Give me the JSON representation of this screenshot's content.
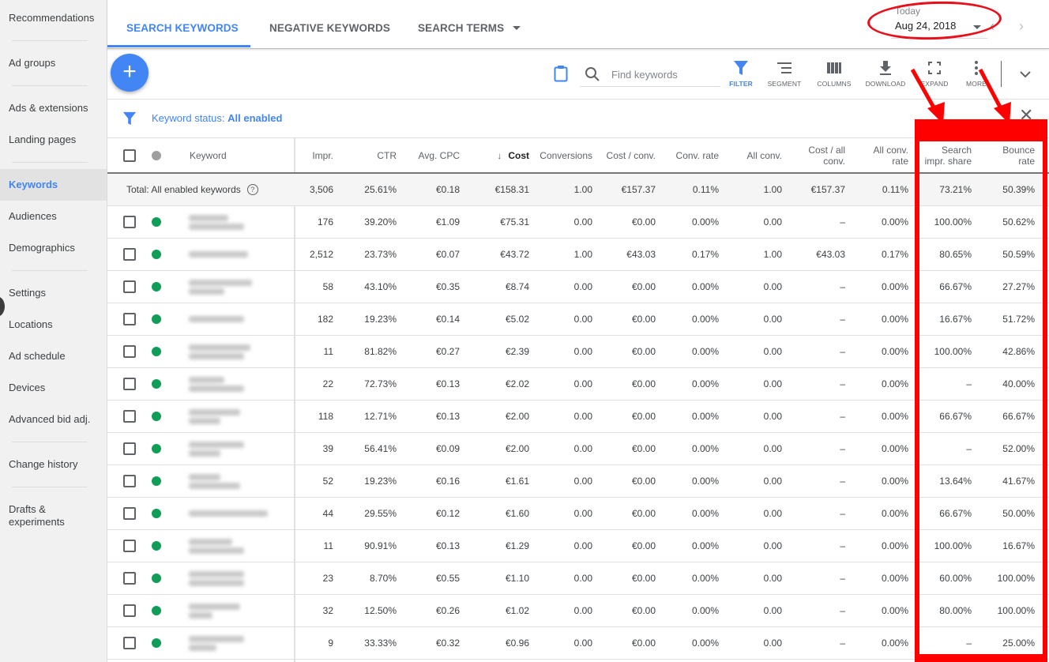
{
  "sidebar": {
    "items": [
      {
        "label": "Recommendations",
        "active": false
      },
      {
        "label": "Ad groups",
        "active": false
      },
      {
        "label": "Ads & extensions",
        "active": false
      },
      {
        "label": "Landing pages",
        "active": false
      },
      {
        "label": "Keywords",
        "active": true
      },
      {
        "label": "Audiences",
        "active": false
      },
      {
        "label": "Demographics",
        "active": false
      },
      {
        "label": "Settings",
        "active": false
      },
      {
        "label": "Locations",
        "active": false
      },
      {
        "label": "Ad schedule",
        "active": false
      },
      {
        "label": "Devices",
        "active": false
      },
      {
        "label": "Advanced bid adj.",
        "active": false
      },
      {
        "label": "Change history",
        "active": false
      },
      {
        "label": "Drafts & experiments",
        "active": false
      }
    ]
  },
  "tabs": [
    {
      "label": "SEARCH KEYWORDS",
      "active": true
    },
    {
      "label": "NEGATIVE KEYWORDS",
      "active": false
    },
    {
      "label": "SEARCH TERMS",
      "active": false
    }
  ],
  "date_range": {
    "label": "Today",
    "value": "Aug 24, 2018"
  },
  "toolbar": {
    "add_icon": "plus-icon",
    "search_placeholder": "Find keywords",
    "filter_label": "FILTER",
    "segment_label": "SEGMENT",
    "columns_label": "COLUMNS",
    "download_label": "DOWNLOAD",
    "expand_label": "EXPAND",
    "more_label": "MORE"
  },
  "filter": {
    "prefix": "Keyword status: ",
    "value": "All enabled"
  },
  "table": {
    "headers": {
      "keyword": "Keyword",
      "impr": "Impr.",
      "ctr": "CTR",
      "avg_cpc": "Avg. CPC",
      "cost": "Cost",
      "conversions": "Conversions",
      "cost_conv": "Cost / conv.",
      "conv_rate": "Conv. rate",
      "all_conv": "All conv.",
      "cost_all_conv": "Cost / all conv.",
      "all_conv_rate": "All conv. rate",
      "search_impr_share": "Search impr. share",
      "bounce_rate": "Bounce rate"
    },
    "sort_icon": "arrow-down-icon",
    "total": {
      "label": "Total: All enabled keywords",
      "impr": "3,506",
      "ctr": "25.61%",
      "avg_cpc": "€0.18",
      "cost": "€158.31",
      "conversions": "1.00",
      "cost_conv": "€157.37",
      "conv_rate": "0.11%",
      "all_conv": "1.00",
      "cost_all_conv": "€157.37",
      "all_conv_rate": "0.11%",
      "search_impr_share": "73.21%",
      "bounce_rate": "50.39%"
    },
    "status_color": "#0f9d58",
    "rows": [
      {
        "impr": "176",
        "ctr": "39.20%",
        "avg_cpc": "€1.09",
        "cost": "€75.31",
        "conversions": "0.00",
        "cost_conv": "€0.00",
        "conv_rate": "0.00%",
        "all_conv": "0.00",
        "cost_all_conv": "–",
        "all_conv_rate": "0.00%",
        "search_impr_share": "100.00%",
        "bounce_rate": "50.62%"
      },
      {
        "impr": "2,512",
        "ctr": "23.73%",
        "avg_cpc": "€0.07",
        "cost": "€43.72",
        "conversions": "1.00",
        "cost_conv": "€43.03",
        "conv_rate": "0.17%",
        "all_conv": "1.00",
        "cost_all_conv": "€43.03",
        "all_conv_rate": "0.17%",
        "search_impr_share": "80.65%",
        "bounce_rate": "50.59%"
      },
      {
        "impr": "58",
        "ctr": "43.10%",
        "avg_cpc": "€0.35",
        "cost": "€8.74",
        "conversions": "0.00",
        "cost_conv": "€0.00",
        "conv_rate": "0.00%",
        "all_conv": "0.00",
        "cost_all_conv": "–",
        "all_conv_rate": "0.00%",
        "search_impr_share": "66.67%",
        "bounce_rate": "27.27%"
      },
      {
        "impr": "182",
        "ctr": "19.23%",
        "avg_cpc": "€0.14",
        "cost": "€5.02",
        "conversions": "0.00",
        "cost_conv": "€0.00",
        "conv_rate": "0.00%",
        "all_conv": "0.00",
        "cost_all_conv": "–",
        "all_conv_rate": "0.00%",
        "search_impr_share": "16.67%",
        "bounce_rate": "51.72%"
      },
      {
        "impr": "11",
        "ctr": "81.82%",
        "avg_cpc": "€0.27",
        "cost": "€2.39",
        "conversions": "0.00",
        "cost_conv": "€0.00",
        "conv_rate": "0.00%",
        "all_conv": "0.00",
        "cost_all_conv": "–",
        "all_conv_rate": "0.00%",
        "search_impr_share": "100.00%",
        "bounce_rate": "42.86%"
      },
      {
        "impr": "22",
        "ctr": "72.73%",
        "avg_cpc": "€0.13",
        "cost": "€2.02",
        "conversions": "0.00",
        "cost_conv": "€0.00",
        "conv_rate": "0.00%",
        "all_conv": "0.00",
        "cost_all_conv": "–",
        "all_conv_rate": "0.00%",
        "search_impr_share": "–",
        "bounce_rate": "40.00%"
      },
      {
        "impr": "118",
        "ctr": "12.71%",
        "avg_cpc": "€0.13",
        "cost": "€2.00",
        "conversions": "0.00",
        "cost_conv": "€0.00",
        "conv_rate": "0.00%",
        "all_conv": "0.00",
        "cost_all_conv": "–",
        "all_conv_rate": "0.00%",
        "search_impr_share": "66.67%",
        "bounce_rate": "66.67%"
      },
      {
        "impr": "39",
        "ctr": "56.41%",
        "avg_cpc": "€0.09",
        "cost": "€2.00",
        "conversions": "0.00",
        "cost_conv": "€0.00",
        "conv_rate": "0.00%",
        "all_conv": "0.00",
        "cost_all_conv": "–",
        "all_conv_rate": "0.00%",
        "search_impr_share": "–",
        "bounce_rate": "52.00%"
      },
      {
        "impr": "52",
        "ctr": "19.23%",
        "avg_cpc": "€0.16",
        "cost": "€1.61",
        "conversions": "0.00",
        "cost_conv": "€0.00",
        "conv_rate": "0.00%",
        "all_conv": "0.00",
        "cost_all_conv": "–",
        "all_conv_rate": "0.00%",
        "search_impr_share": "13.64%",
        "bounce_rate": "41.67%"
      },
      {
        "impr": "44",
        "ctr": "29.55%",
        "avg_cpc": "€0.12",
        "cost": "€1.60",
        "conversions": "0.00",
        "cost_conv": "€0.00",
        "conv_rate": "0.00%",
        "all_conv": "0.00",
        "cost_all_conv": "–",
        "all_conv_rate": "0.00%",
        "search_impr_share": "66.67%",
        "bounce_rate": "50.00%"
      },
      {
        "impr": "11",
        "ctr": "90.91%",
        "avg_cpc": "€0.13",
        "cost": "€1.29",
        "conversions": "0.00",
        "cost_conv": "€0.00",
        "conv_rate": "0.00%",
        "all_conv": "0.00",
        "cost_all_conv": "–",
        "all_conv_rate": "0.00%",
        "search_impr_share": "100.00%",
        "bounce_rate": "16.67%"
      },
      {
        "impr": "23",
        "ctr": "8.70%",
        "avg_cpc": "€0.55",
        "cost": "€1.10",
        "conversions": "0.00",
        "cost_conv": "€0.00",
        "conv_rate": "0.00%",
        "all_conv": "0.00",
        "cost_all_conv": "–",
        "all_conv_rate": "0.00%",
        "search_impr_share": "60.00%",
        "bounce_rate": "100.00%"
      },
      {
        "impr": "32",
        "ctr": "12.50%",
        "avg_cpc": "€0.26",
        "cost": "€1.02",
        "conversions": "0.00",
        "cost_conv": "€0.00",
        "conv_rate": "0.00%",
        "all_conv": "0.00",
        "cost_all_conv": "–",
        "all_conv_rate": "0.00%",
        "search_impr_share": "80.00%",
        "bounce_rate": "100.00%"
      },
      {
        "impr": "9",
        "ctr": "33.33%",
        "avg_cpc": "€0.32",
        "cost": "€0.96",
        "conversions": "0.00",
        "cost_conv": "€0.00",
        "conv_rate": "0.00%",
        "all_conv": "0.00",
        "cost_all_conv": "–",
        "all_conv_rate": "0.00%",
        "search_impr_share": "–",
        "bounce_rate": "25.00%"
      }
    ]
  },
  "annotation_color": "#fe0000"
}
